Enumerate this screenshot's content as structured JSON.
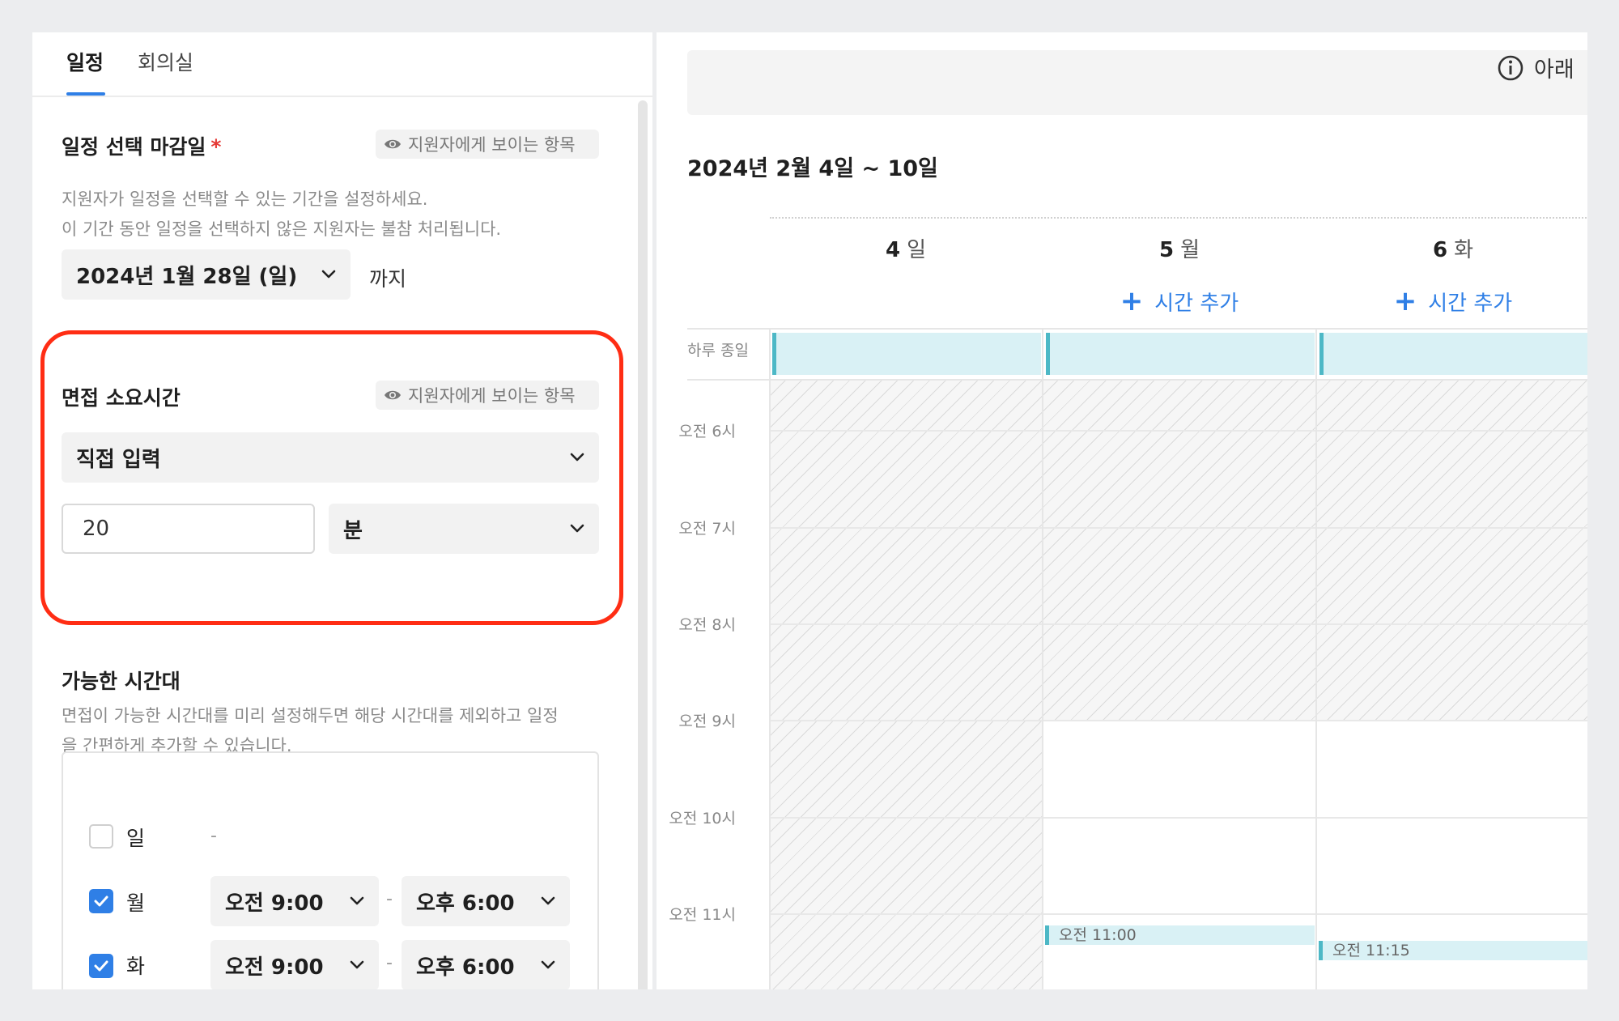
{
  "tabs": [
    {
      "label": "일정",
      "active": true
    },
    {
      "label": "회의실",
      "active": false
    }
  ],
  "deadline": {
    "title": "일정 선택 마감일",
    "required_mark": "*",
    "visibility_chip": "지원자에게 보이는 항목",
    "description": [
      "지원자가 일정을 선택할 수 있는 기간을 설정하세요.",
      "이 기간 동안 일정을 선택하지 않은 지원자는 불참 처리됩니다."
    ],
    "date_value": "2024년 1월 28일 (일)",
    "until_label": "까지"
  },
  "duration": {
    "title": "면접 소요시간",
    "visibility_chip": "지원자에게 보이는 항목",
    "mode_value": "직접 입력",
    "amount_value": "20",
    "unit_value": "분"
  },
  "availability": {
    "title": "가능한 시간대",
    "description": [
      "면접이 가능한 시간대를 미리 설정해두면 해당 시간대를 제외하고 일정",
      "을 간편하게 추가할 수 있습니다."
    ],
    "days": [
      {
        "name": "일",
        "checked": false,
        "empty_text": "-"
      },
      {
        "name": "월",
        "checked": true,
        "start": "오전 9:00",
        "sep": "-",
        "end": "오후 6:00"
      },
      {
        "name": "화",
        "checked": true,
        "start": "오전 9:00",
        "sep": "-",
        "end": "오후 6:00"
      }
    ]
  },
  "calendar": {
    "notice": "아래",
    "week_title": "2024년 2월 4일 ~ 10일",
    "days": [
      {
        "num": "4",
        "weekday": "일"
      },
      {
        "num": "5",
        "weekday": "월",
        "add_time": "시간 추가"
      },
      {
        "num": "6",
        "weekday": "화",
        "add_time": "시간 추가"
      }
    ],
    "allday_label": "하루 종일",
    "hours": [
      "오전 6시",
      "오전 7시",
      "오전 8시",
      "오전 9시",
      "오전 10시",
      "오전 11시"
    ],
    "events": [
      {
        "day": "월",
        "label": "오전 11:00"
      },
      {
        "day": "화",
        "label": "오전 11:15"
      }
    ]
  },
  "colors": {
    "accent": "#2f7fe6",
    "highlight_border": "#ff2d14",
    "event_fill": "#d9f1f5",
    "event_edge": "#4db8c6"
  }
}
